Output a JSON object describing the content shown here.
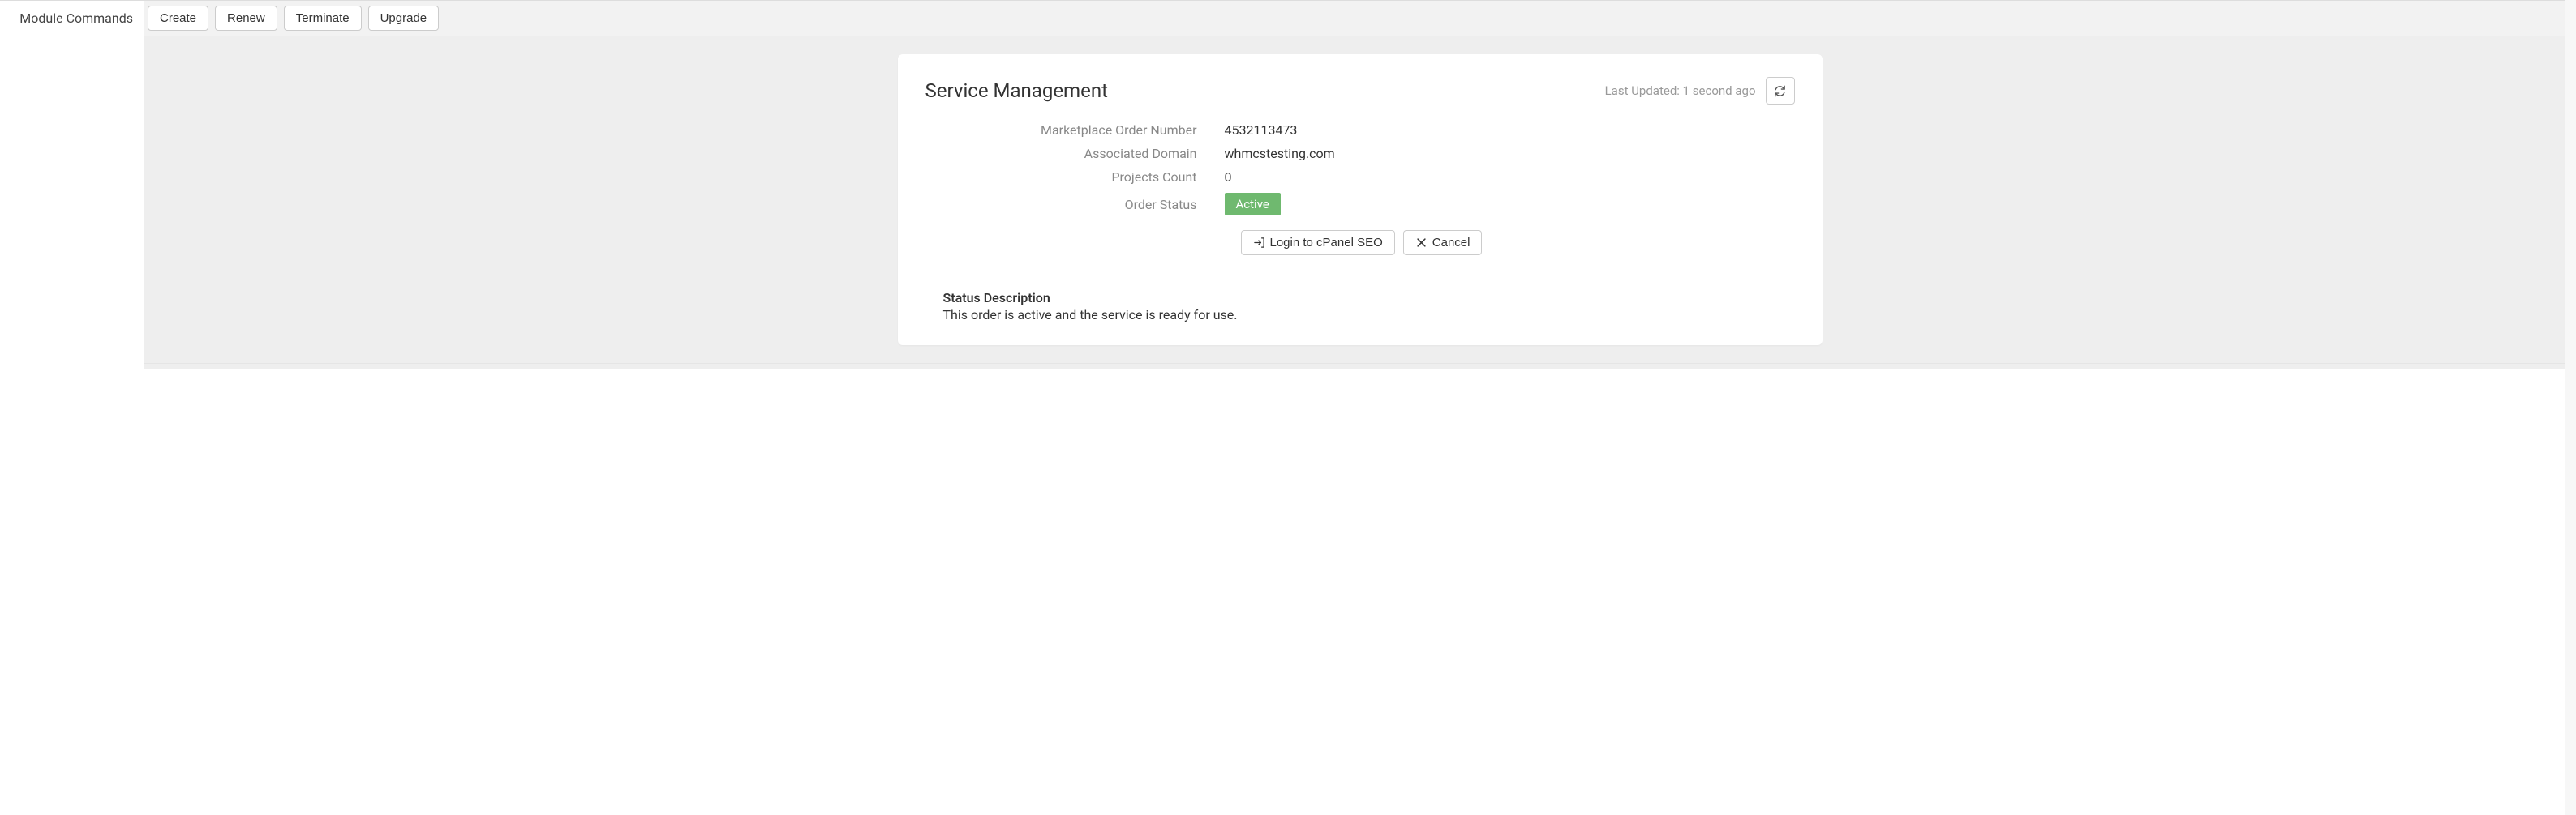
{
  "module_commands": {
    "label": "Module Commands",
    "buttons": {
      "create": "Create",
      "renew": "Renew",
      "terminate": "Terminate",
      "upgrade": "Upgrade"
    }
  },
  "panel": {
    "title": "Service Management",
    "last_updated": "Last Updated: 1 second ago",
    "fields": {
      "order_number_label": "Marketplace Order Number",
      "order_number_value": "4532113473",
      "domain_label": "Associated Domain",
      "domain_value": "whmcstesting.com",
      "projects_label": "Projects Count",
      "projects_value": "0",
      "status_label": "Order Status",
      "status_value": "Active"
    },
    "actions": {
      "login_cpanel": "Login to cPanel SEO",
      "cancel": "Cancel"
    },
    "status_description": {
      "title": "Status Description",
      "text": "This order is active and the service is ready for use."
    }
  }
}
